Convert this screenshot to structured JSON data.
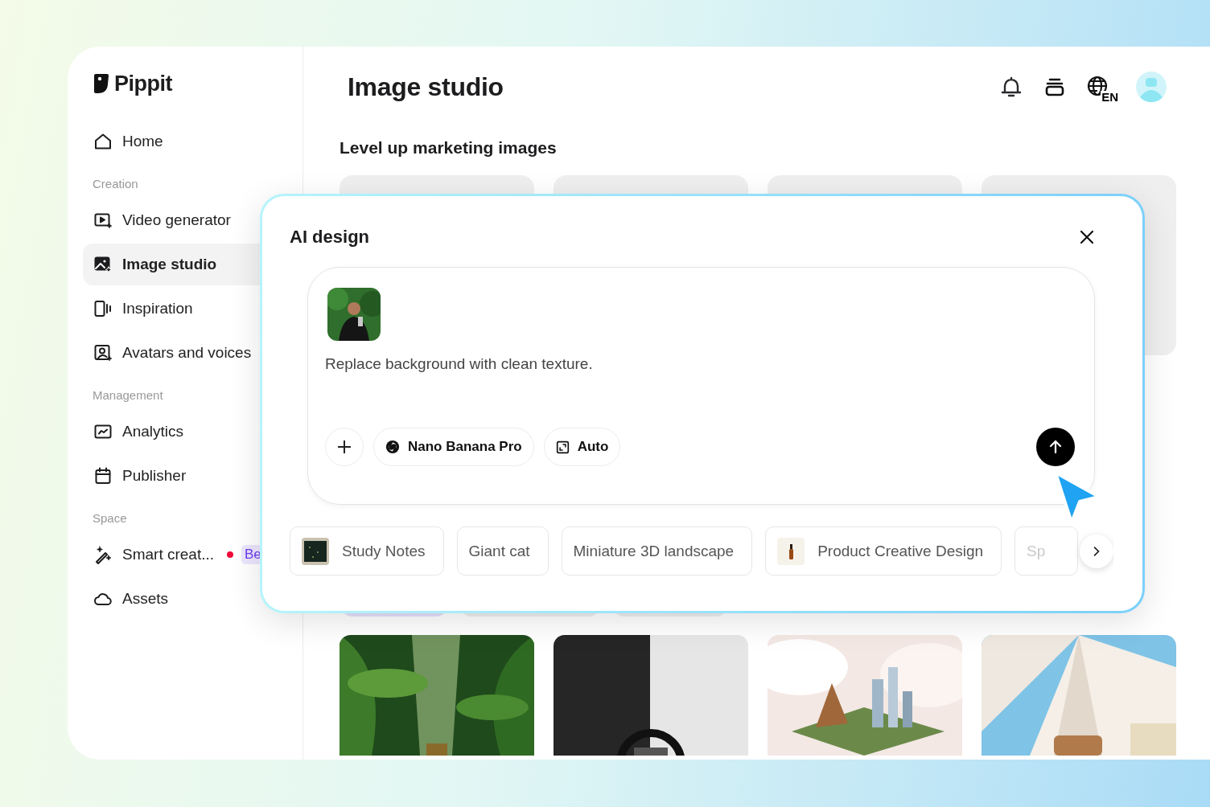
{
  "brand": {
    "name": "Pippit"
  },
  "sidebar": {
    "sections": [
      {
        "items": [
          {
            "label": "Home",
            "selected": false
          }
        ]
      },
      {
        "heading": "Creation",
        "items": [
          {
            "label": "Video generator",
            "selected": false
          },
          {
            "label": "Image studio",
            "selected": true
          },
          {
            "label": "Inspiration",
            "selected": false
          },
          {
            "label": "Avatars and voices",
            "selected": false
          }
        ]
      },
      {
        "heading": "Management",
        "items": [
          {
            "label": "Analytics",
            "selected": false
          },
          {
            "label": "Publisher",
            "selected": false
          }
        ]
      },
      {
        "heading": "Space",
        "items": [
          {
            "label": "Smart creat...",
            "selected": false,
            "new_dot": true,
            "badge": "Be"
          },
          {
            "label": "Assets",
            "selected": false
          }
        ]
      }
    ]
  },
  "header": {
    "title": "Image studio",
    "language": "EN"
  },
  "main": {
    "section_title": "Level up marketing images"
  },
  "dialog": {
    "title": "AI design",
    "prompt": "Replace background with clean texture.",
    "model": "Nano Banana Pro",
    "ratio": "Auto",
    "suggestions": [
      {
        "label": "Study Notes",
        "thumbnail": true
      },
      {
        "label": "Giant cat",
        "thumbnail": false
      },
      {
        "label": "Miniature 3D landscape",
        "thumbnail": false
      },
      {
        "label": "Product Creative Design",
        "thumbnail": true
      },
      {
        "label": "Sp",
        "thumbnail": false
      }
    ]
  }
}
